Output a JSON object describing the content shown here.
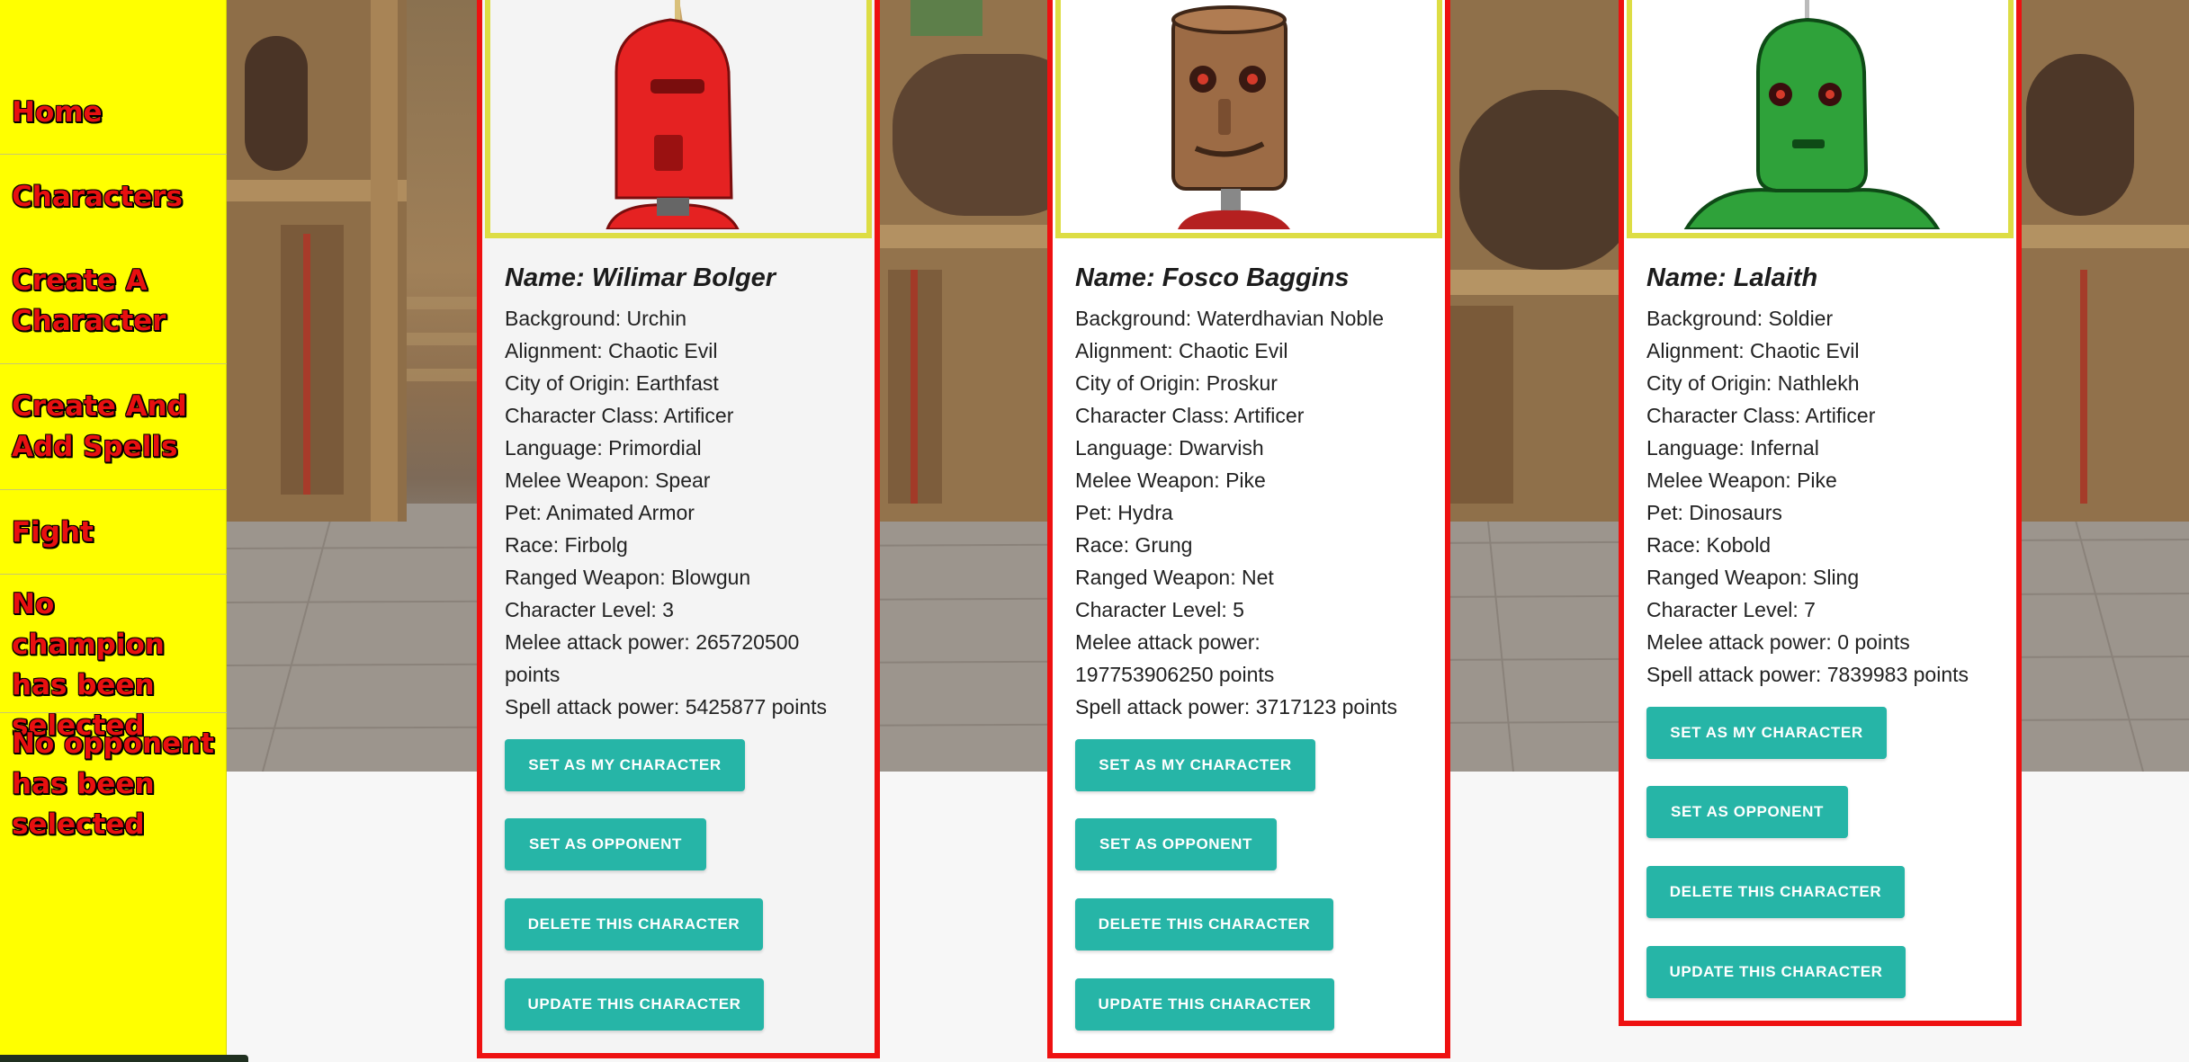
{
  "nav": {
    "items": [
      {
        "label": "Home"
      },
      {
        "label": "Characters"
      },
      {
        "label": "Create A Character"
      },
      {
        "label": "Create And Add Spells"
      },
      {
        "label": "Fight"
      },
      {
        "label": "No champion has been selected"
      },
      {
        "label": "No opponent has been selected"
      }
    ]
  },
  "colors": {
    "sidebar_bg": "#ffff00",
    "nav_text": "#e81010",
    "card_border": "#ee1111",
    "portrait_frame": "#dddd44",
    "button_bg": "#26b5a7",
    "button_text": "#ffffff"
  },
  "buttons": {
    "set_character": "SET AS MY CHARACTER",
    "set_opponent": "SET AS OPPONENT",
    "delete": "DELETE THIS CHARACTER",
    "update": "UPDATE THIS CHARACTER"
  },
  "characters": [
    {
      "portrait": "red-robot-portrait",
      "name": "Name: Wilimar Bolger",
      "background": "Background: Urchin",
      "alignment": "Alignment: Chaotic Evil",
      "city": "City of Origin: Earthfast",
      "char_class": "Character Class: Artificer",
      "language": "Language: Primordial",
      "melee_weapon": "Melee Weapon: Spear",
      "pet": "Pet: Animated Armor",
      "race": "Race: Firbolg",
      "ranged_weapon": "Ranged Weapon: Blowgun",
      "level": "Character Level: 3",
      "melee_power": "Melee attack power: 265720500 points",
      "spell_power": "Spell attack power: 5425877 points"
    },
    {
      "portrait": "wooden-robot-portrait",
      "name": "Name: Fosco Baggins",
      "background": "Background: Waterdhavian Noble",
      "alignment": "Alignment: Chaotic Evil",
      "city": "City of Origin: Proskur",
      "char_class": "Character Class: Artificer",
      "language": "Language: Dwarvish",
      "melee_weapon": "Melee Weapon: Pike",
      "pet": "Pet: Hydra",
      "race": "Race: Grung",
      "ranged_weapon": "Ranged Weapon: Net",
      "level": "Character Level: 5",
      "melee_power": "Melee attack power: 197753906250 points",
      "spell_power": "Spell attack power: 3717123 points"
    },
    {
      "portrait": "green-robot-portrait",
      "name": "Name: Lalaith",
      "background": "Background: Soldier",
      "alignment": "Alignment: Chaotic Evil",
      "city": "City of Origin: Nathlekh",
      "char_class": "Character Class: Artificer",
      "language": "Language: Infernal",
      "melee_weapon": "Melee Weapon: Pike",
      "pet": "Pet: Dinosaurs",
      "race": "Race: Kobold",
      "ranged_weapon": "Ranged Weapon: Sling",
      "level": "Character Level: 7",
      "melee_power": "Melee attack power: 0 points",
      "spell_power": "Spell attack power: 7839983 points"
    }
  ]
}
